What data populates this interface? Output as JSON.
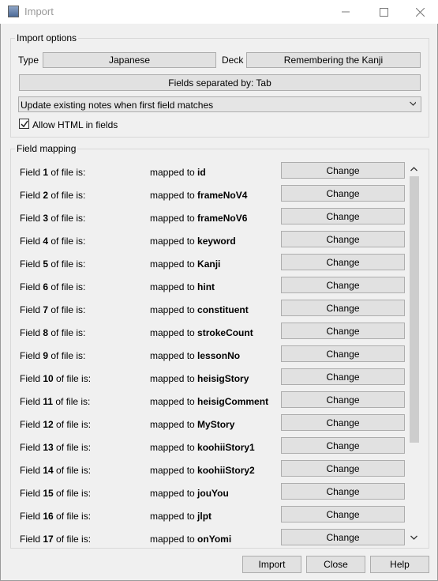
{
  "window": {
    "title": "Import",
    "minimize_label": "—",
    "maximize_label": "☐",
    "close_label": "✕"
  },
  "import_options": {
    "title": "Import options",
    "type_label": "Type",
    "type_value": "Japanese",
    "deck_label": "Deck",
    "deck_value": "Remembering the Kanji",
    "separator_label": "Fields separated by: Tab",
    "update_mode": "Update existing notes when first field matches",
    "allow_html_label": "Allow HTML in fields",
    "allow_html_checked": true
  },
  "field_mapping": {
    "title": "Field mapping",
    "field_prefix": "Field ",
    "field_suffix": " of file is:",
    "mapped_prefix": "mapped to ",
    "change_label": "Change",
    "rows": [
      {
        "n": "1",
        "target": "id"
      },
      {
        "n": "2",
        "target": "frameNoV4"
      },
      {
        "n": "3",
        "target": "frameNoV6"
      },
      {
        "n": "4",
        "target": "keyword"
      },
      {
        "n": "5",
        "target": "Kanji"
      },
      {
        "n": "6",
        "target": "hint"
      },
      {
        "n": "7",
        "target": "constituent"
      },
      {
        "n": "8",
        "target": "strokeCount"
      },
      {
        "n": "9",
        "target": "lessonNo"
      },
      {
        "n": "10",
        "target": "heisigStory"
      },
      {
        "n": "11",
        "target": "heisigComment"
      },
      {
        "n": "12",
        "target": "MyStory"
      },
      {
        "n": "13",
        "target": "koohiiStory1"
      },
      {
        "n": "14",
        "target": "koohiiStory2"
      },
      {
        "n": "15",
        "target": "jouYou"
      },
      {
        "n": "16",
        "target": "jlpt"
      },
      {
        "n": "17",
        "target": "onYomi"
      }
    ]
  },
  "buttons": {
    "import": "Import",
    "close": "Close",
    "help": "Help"
  }
}
